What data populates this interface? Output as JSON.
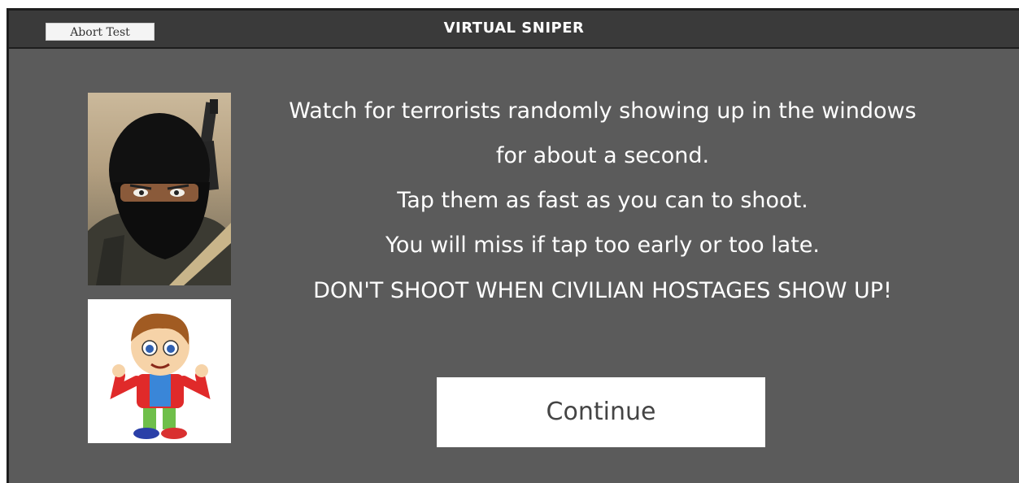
{
  "header": {
    "title": "VIRTUAL SNIPER",
    "abort_label": "Abort Test"
  },
  "instructions": {
    "line1": "Watch for terrorists randomly showing up in the windows for about a second.",
    "line2": "Tap them as fast as you can to shoot.",
    "line3": "You will miss if tap too early or too late.",
    "warning": "DON'T SHOOT WHEN CIVILIAN HOSTAGES SHOW UP!"
  },
  "actions": {
    "continue_label": "Continue"
  },
  "images": {
    "terrorist": "masked-terrorist-with-rifle",
    "civilian": "cartoon-boy-hostage"
  },
  "colors": {
    "background": "#5b5b5b",
    "titlebar": "#3a3a3a",
    "text": "#ffffff",
    "button": "#ffffff"
  }
}
